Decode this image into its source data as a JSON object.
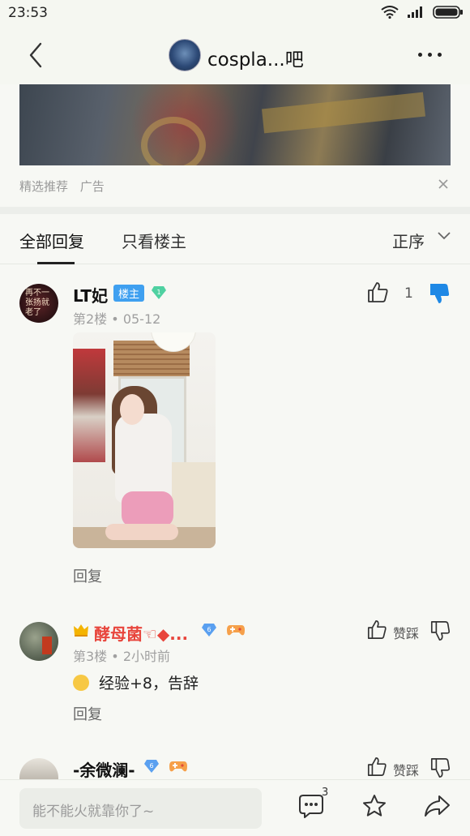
{
  "status_bar": {
    "time": "23:53"
  },
  "header": {
    "title": "cospla...吧"
  },
  "ad": {
    "label_1": "精选推荐",
    "label_2": "广告"
  },
  "tabs": {
    "all": "全部回复",
    "op_only": "只看楼主",
    "sort": "正序"
  },
  "posts": [
    {
      "avatar_text": "再不一张扬就老了",
      "name": "LT妃",
      "host_badge": "楼主",
      "level": "1",
      "floor": "第2楼",
      "time": "05-12",
      "likes": "1",
      "reply": "回复"
    },
    {
      "name": "酵母菌☜◆...",
      "level": "6",
      "floor": "第3楼",
      "time": "2小时前",
      "content": "经验+8，告辞",
      "like_label": "赞踩",
      "reply": "回复"
    },
    {
      "name": "-余微澜-",
      "level": "6",
      "like_label": "赞踩"
    }
  ],
  "bottom": {
    "input_placeholder": "能不能火就靠你了~",
    "comment_count": "3"
  },
  "colors": {
    "accent_blue": "#3fa0f0",
    "name_red": "#e8453c",
    "dislike_active": "#1e88e5"
  }
}
